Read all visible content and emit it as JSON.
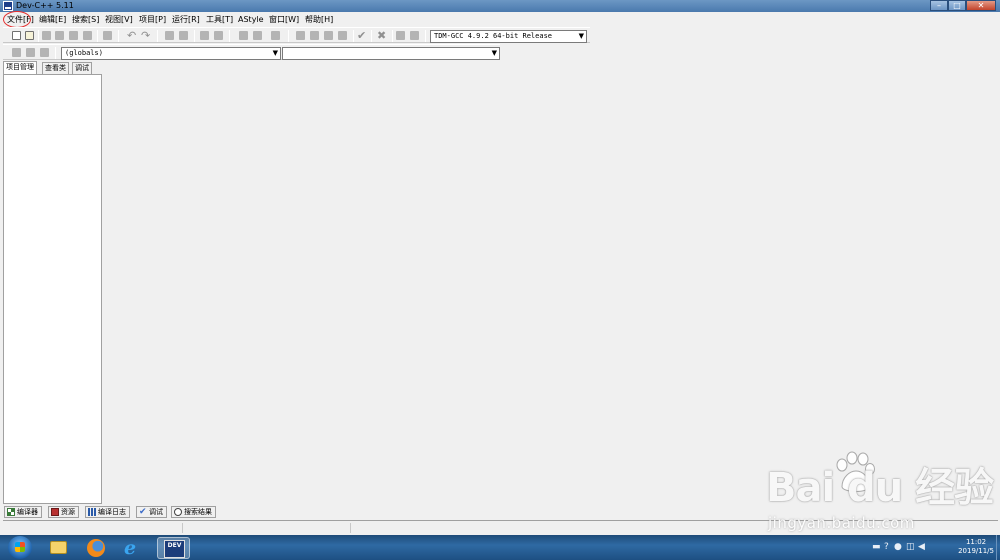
{
  "window": {
    "title": "Dev-C++ 5.11",
    "controls": [
      "–",
      "□",
      "✕"
    ]
  },
  "menu": [
    "文件[F]",
    "编辑[E]",
    "搜索[S]",
    "视图[V]",
    "项目[P]",
    "运行[R]",
    "工具[T]",
    "AStyle",
    "窗口[W]",
    "帮助[H]"
  ],
  "toolbar": {
    "compiler_select": "TDM-GCC 4.9.2 64-bit Release"
  },
  "toolbar2": {
    "scope_select": "(globals)",
    "member_select": ""
  },
  "left_panel": {
    "tabs": [
      "项目管理",
      "查看类",
      "调试"
    ]
  },
  "bottom_tabs": [
    "编译器",
    "资源",
    "编译日志",
    "调试",
    "搜索结果"
  ],
  "taskbar": {
    "clock_time": "11:02",
    "clock_date": "2019/11/5",
    "app_icon_label": "DEV"
  },
  "watermark": {
    "logo": "Bai du 经验",
    "url": "jingyan.baidu.com"
  },
  "colors": {
    "highlight_circle": "#e53030",
    "taskbar": "#2f6aa3",
    "titlebar": "#6c97c4"
  }
}
